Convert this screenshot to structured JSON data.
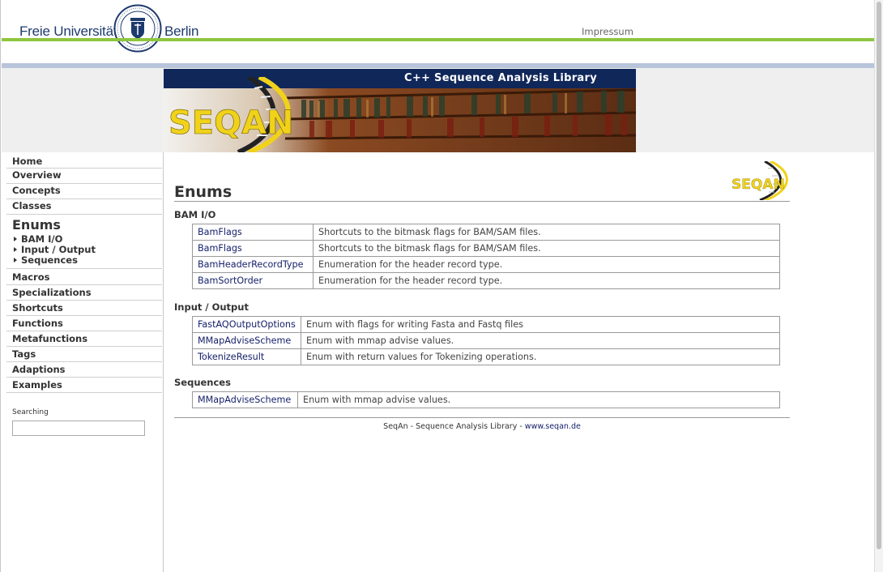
{
  "header": {
    "brand_left": "Freie Universität",
    "brand_right": "Berlin",
    "impressum": "Impressum"
  },
  "banner": {
    "title": "C++ Sequence Analysis Library",
    "logo_text": "SEQAN"
  },
  "sidebar": {
    "items_top": [
      {
        "label": "Home"
      },
      {
        "label": "Overview"
      },
      {
        "label": "Concepts"
      },
      {
        "label": "Classes"
      }
    ],
    "current": "Enums",
    "subitems": [
      {
        "label": "BAM I/O"
      },
      {
        "label": "Input / Output"
      },
      {
        "label": "Sequences"
      }
    ],
    "items_bottom": [
      {
        "label": "Macros"
      },
      {
        "label": "Specializations"
      },
      {
        "label": "Shortcuts"
      },
      {
        "label": "Functions"
      },
      {
        "label": "Metafunctions"
      },
      {
        "label": "Tags"
      },
      {
        "label": "Adaptions"
      },
      {
        "label": "Examples"
      }
    ],
    "search_label": "Searching",
    "search_value": ""
  },
  "main": {
    "title": "Enums",
    "sections": [
      {
        "heading": "BAM I/O",
        "rows": [
          {
            "name": "BamFlags",
            "desc": "Shortcuts to the bitmask flags for BAM/SAM files."
          },
          {
            "name": "BamFlags",
            "desc": "Shortcuts to the bitmask flags for BAM/SAM files."
          },
          {
            "name": "BamHeaderRecordType",
            "desc": "Enumeration for the header record type."
          },
          {
            "name": "BamSortOrder",
            "desc": "Enumeration for the header record type."
          }
        ]
      },
      {
        "heading": "Input / Output",
        "rows": [
          {
            "name": "FastAQOutputOptions",
            "desc": "Enum with flags for writing Fasta and Fastq files"
          },
          {
            "name": "MMapAdviseScheme",
            "desc": "Enum with mmap advise values."
          },
          {
            "name": "TokenizeResult",
            "desc": "Enum with return values for Tokenizing operations."
          }
        ]
      },
      {
        "heading": "Sequences",
        "rows": [
          {
            "name": "MMapAdviseScheme",
            "desc": "Enum with mmap advise values."
          }
        ]
      }
    ]
  },
  "footer": {
    "text": "SeqAn - Sequence Analysis Library - ",
    "link": "www.seqan.de"
  }
}
